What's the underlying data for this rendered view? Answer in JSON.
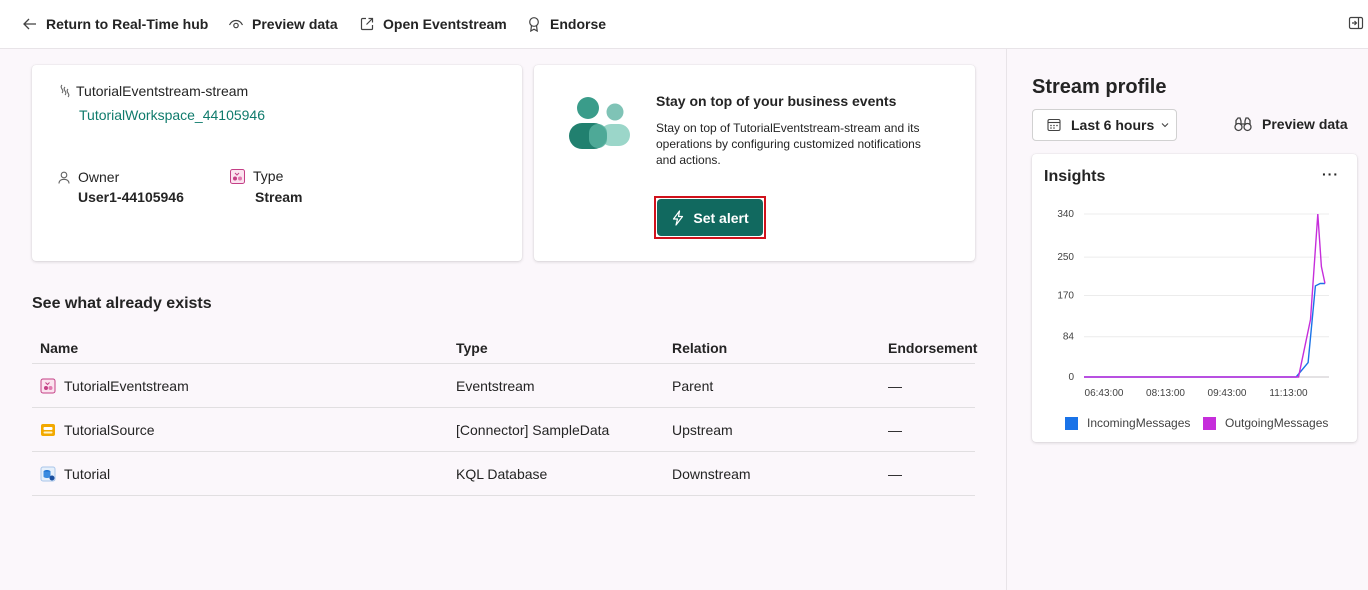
{
  "toolbar": {
    "return_label": "Return to Real-Time hub",
    "preview_label": "Preview data",
    "open_label": "Open Eventstream",
    "endorse_label": "Endorse"
  },
  "stream_card": {
    "name": "TutorialEventstream-stream",
    "workspace": "TutorialWorkspace_44105946",
    "owner_label": "Owner",
    "owner_value": "User1-44105946",
    "type_label": "Type",
    "type_value": "Stream"
  },
  "alert_card": {
    "title": "Stay on top of your business events",
    "description": "Stay on top of TutorialEventstream-stream and its operations by configuring customized notifications and actions.",
    "button_label": "Set alert"
  },
  "existing": {
    "title": "See what already exists",
    "columns": [
      "Name",
      "Type",
      "Relation",
      "Endorsement"
    ],
    "rows": [
      {
        "name": "TutorialEventstream",
        "type": "Eventstream",
        "relation": "Parent",
        "endorsement": "—",
        "icon": "eventstream-icon"
      },
      {
        "name": "TutorialSource",
        "type": "[Connector] SampleData",
        "relation": "Upstream",
        "endorsement": "—",
        "icon": "connector-icon"
      },
      {
        "name": "Tutorial",
        "type": "KQL Database",
        "relation": "Downstream",
        "endorsement": "—",
        "icon": "kql-database-icon"
      }
    ]
  },
  "profile": {
    "title": "Stream profile",
    "time_range": "Last 6 hours",
    "preview_label": "Preview data",
    "insights_title": "Insights",
    "more_label": "···"
  },
  "colors": {
    "accent": "#11695f",
    "link": "#0f7b6c",
    "incoming": "#1a73e8",
    "outgoing": "#c62edb",
    "highlight": "#d0121c"
  },
  "chart_data": {
    "type": "line",
    "x": [
      "06:43:00",
      "08:13:00",
      "09:43:00",
      "11:13:00"
    ],
    "yticks": [
      0,
      84,
      170,
      250,
      340
    ],
    "ylim": [
      0,
      340
    ],
    "grid": true,
    "legend": "bottom",
    "series": [
      {
        "name": "IncomingMessages",
        "color": "#1a73e8",
        "points": [
          [
            0,
            0
          ],
          [
            0.1,
            0
          ],
          [
            0.2,
            0
          ],
          [
            0.3,
            0
          ],
          [
            0.4,
            0
          ],
          [
            0.5,
            0
          ],
          [
            0.6,
            0
          ],
          [
            0.7,
            0
          ],
          [
            0.8,
            0
          ],
          [
            0.88,
            0
          ],
          [
            0.93,
            30
          ],
          [
            0.96,
            190
          ],
          [
            0.98,
            195
          ],
          [
            1.0,
            195
          ]
        ]
      },
      {
        "name": "OutgoingMessages",
        "color": "#c62edb",
        "points": [
          [
            0,
            0
          ],
          [
            0.1,
            0
          ],
          [
            0.2,
            0
          ],
          [
            0.3,
            0
          ],
          [
            0.4,
            0
          ],
          [
            0.5,
            0
          ],
          [
            0.6,
            0
          ],
          [
            0.7,
            0
          ],
          [
            0.8,
            0
          ],
          [
            0.89,
            0
          ],
          [
            0.94,
            120
          ],
          [
            0.97,
            340
          ],
          [
            0.985,
            230
          ],
          [
            1.0,
            195
          ]
        ]
      }
    ]
  }
}
